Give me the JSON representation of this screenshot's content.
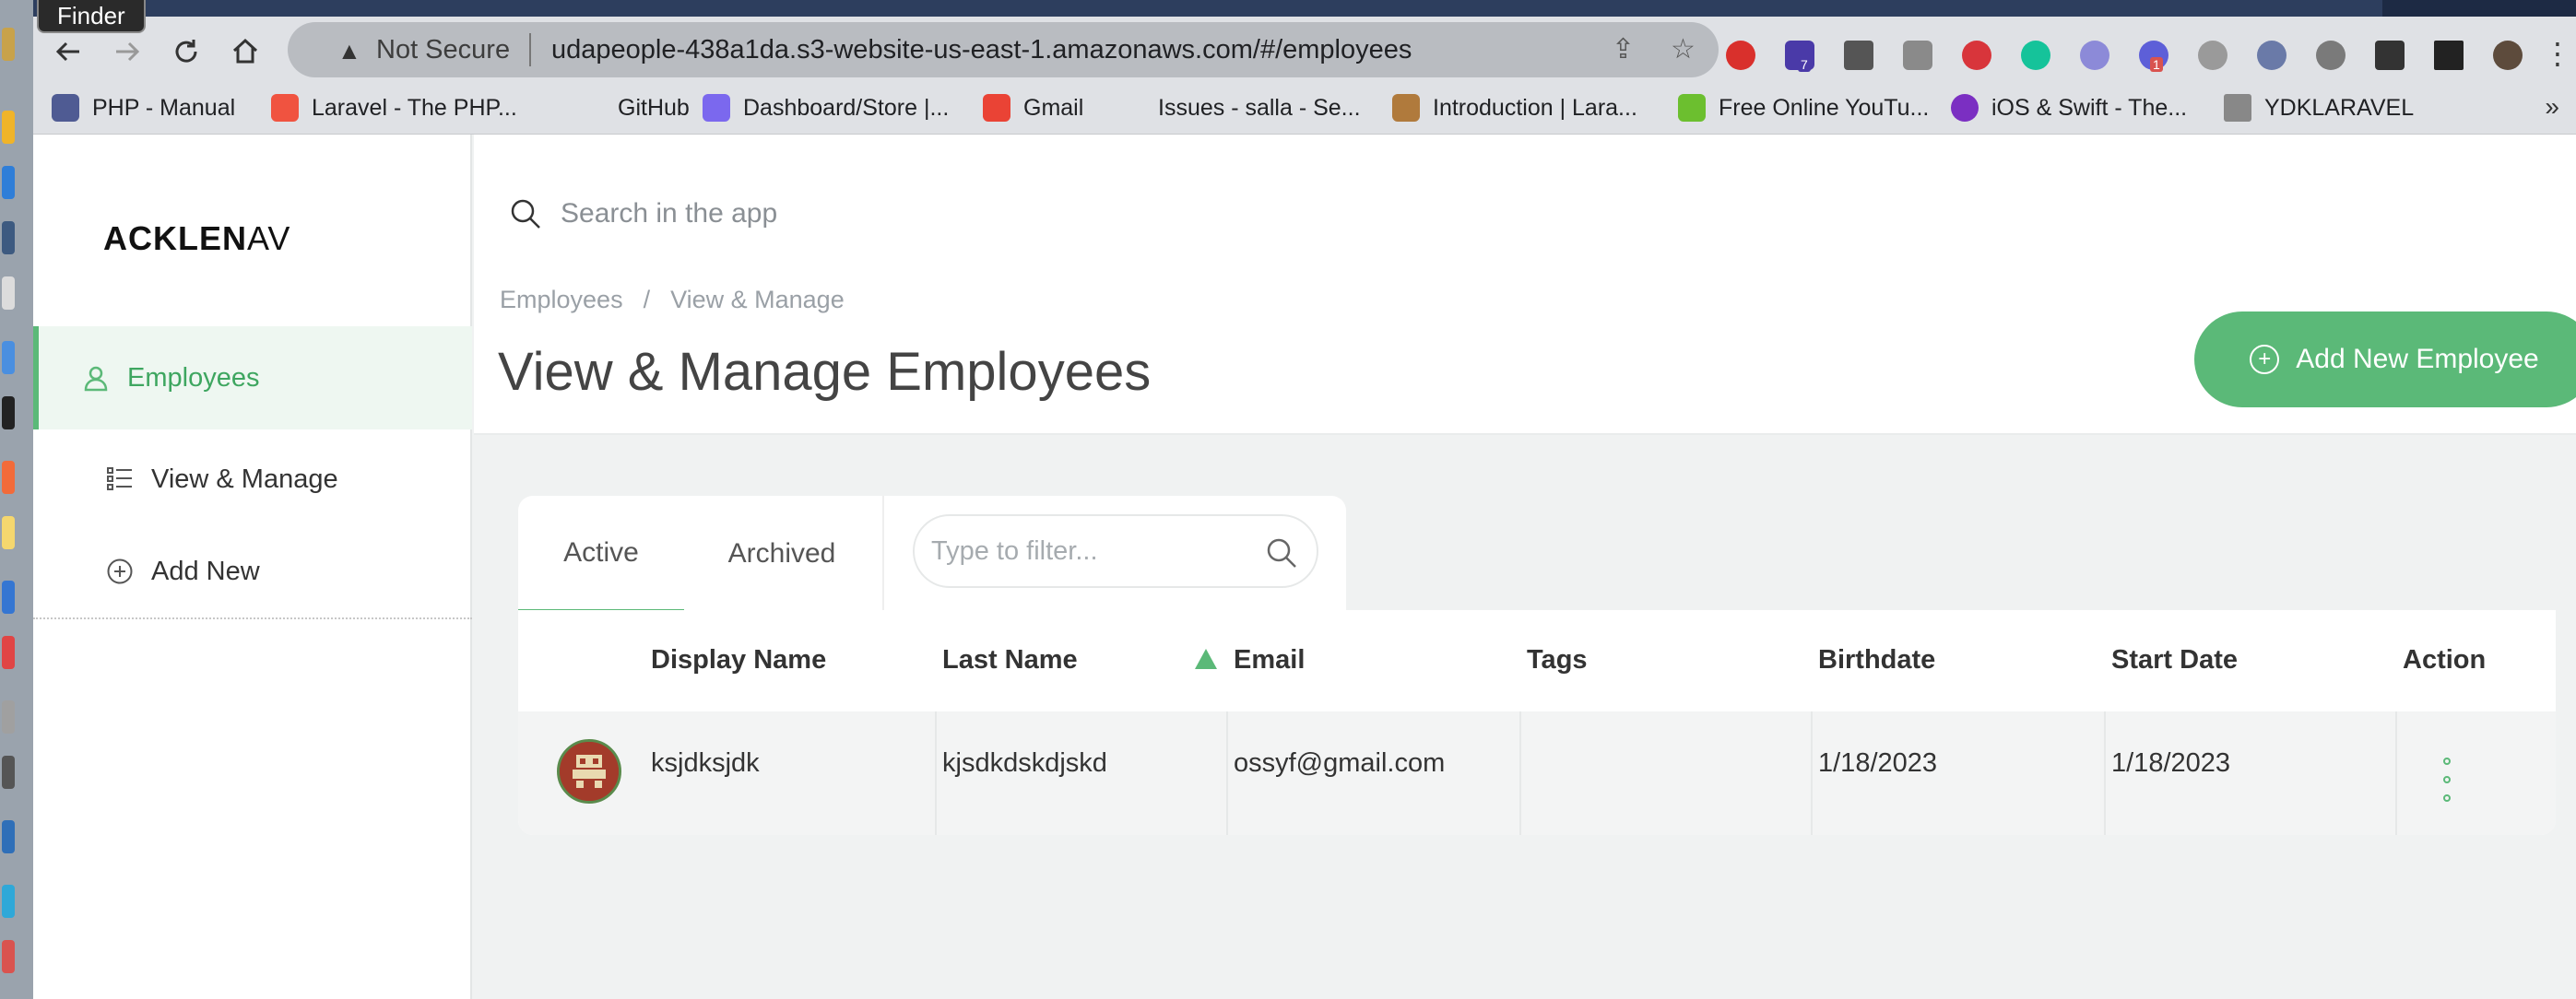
{
  "browser": {
    "finder_tooltip": "Finder",
    "security_label": "Not Secure",
    "url": "udapeople-438a1da.s3-website-us-east-1.amazonaws.com/#/employees",
    "extension_badges": [
      "7",
      "1"
    ],
    "bookmarks": [
      {
        "label": "PHP - Manual",
        "icon": "php-icon",
        "color": "#4f5b93"
      },
      {
        "label": "Laravel - The PHP...",
        "icon": "laravel-icon",
        "color": "#f05340"
      },
      {
        "label": "GitHub",
        "icon": "github-icon",
        "color": "#24292e"
      },
      {
        "label": "Dashboard/Store |...",
        "icon": "clickup-icon",
        "color": "#7b68ee"
      },
      {
        "label": "Gmail",
        "icon": "gmail-icon",
        "color": "#ea4335"
      },
      {
        "label": "Issues - salla - Se...",
        "icon": "sentry-icon",
        "color": "#362d59"
      },
      {
        "label": "Introduction | Lara...",
        "icon": "package-icon",
        "color": "#b07a3c"
      },
      {
        "label": "Free Online YouTu...",
        "icon": "download-icon",
        "color": "#6cbf2f"
      },
      {
        "label": "iOS & Swift - The...",
        "icon": "udemy-icon",
        "color": "#7b2fc2"
      },
      {
        "label": "YDKLARAVEL",
        "icon": "folder-icon",
        "color": "#888888"
      }
    ]
  },
  "app": {
    "logo_bold": "ACKLEN",
    "logo_light": "AV",
    "search_placeholder": "Search in the app",
    "sidebar": {
      "section": "Employees",
      "items": [
        {
          "label": "View & Manage",
          "icon": "list-icon"
        },
        {
          "label": "Add New",
          "icon": "plus-circle-icon"
        }
      ]
    },
    "breadcrumb": [
      "Employees",
      "View & Manage"
    ],
    "title": "View & Manage Employees",
    "add_button": "Add New Employee",
    "tabs": [
      "Active",
      "Archived"
    ],
    "filter_placeholder": "Type to filter...",
    "table": {
      "columns": [
        "Display Name",
        "Last Name",
        "Email",
        "Tags",
        "Birthdate",
        "Start Date",
        "Action"
      ],
      "rows": [
        {
          "display_name": "ksjdksjdk",
          "last_name": "kjsdkdskdjskd",
          "email": "ossyf@gmail.com",
          "tags": "",
          "birthdate": "1/18/2023",
          "start_date": "1/18/2023"
        }
      ]
    },
    "colors": {
      "accent": "#5bb978",
      "active_bg": "#eef7f1"
    }
  }
}
